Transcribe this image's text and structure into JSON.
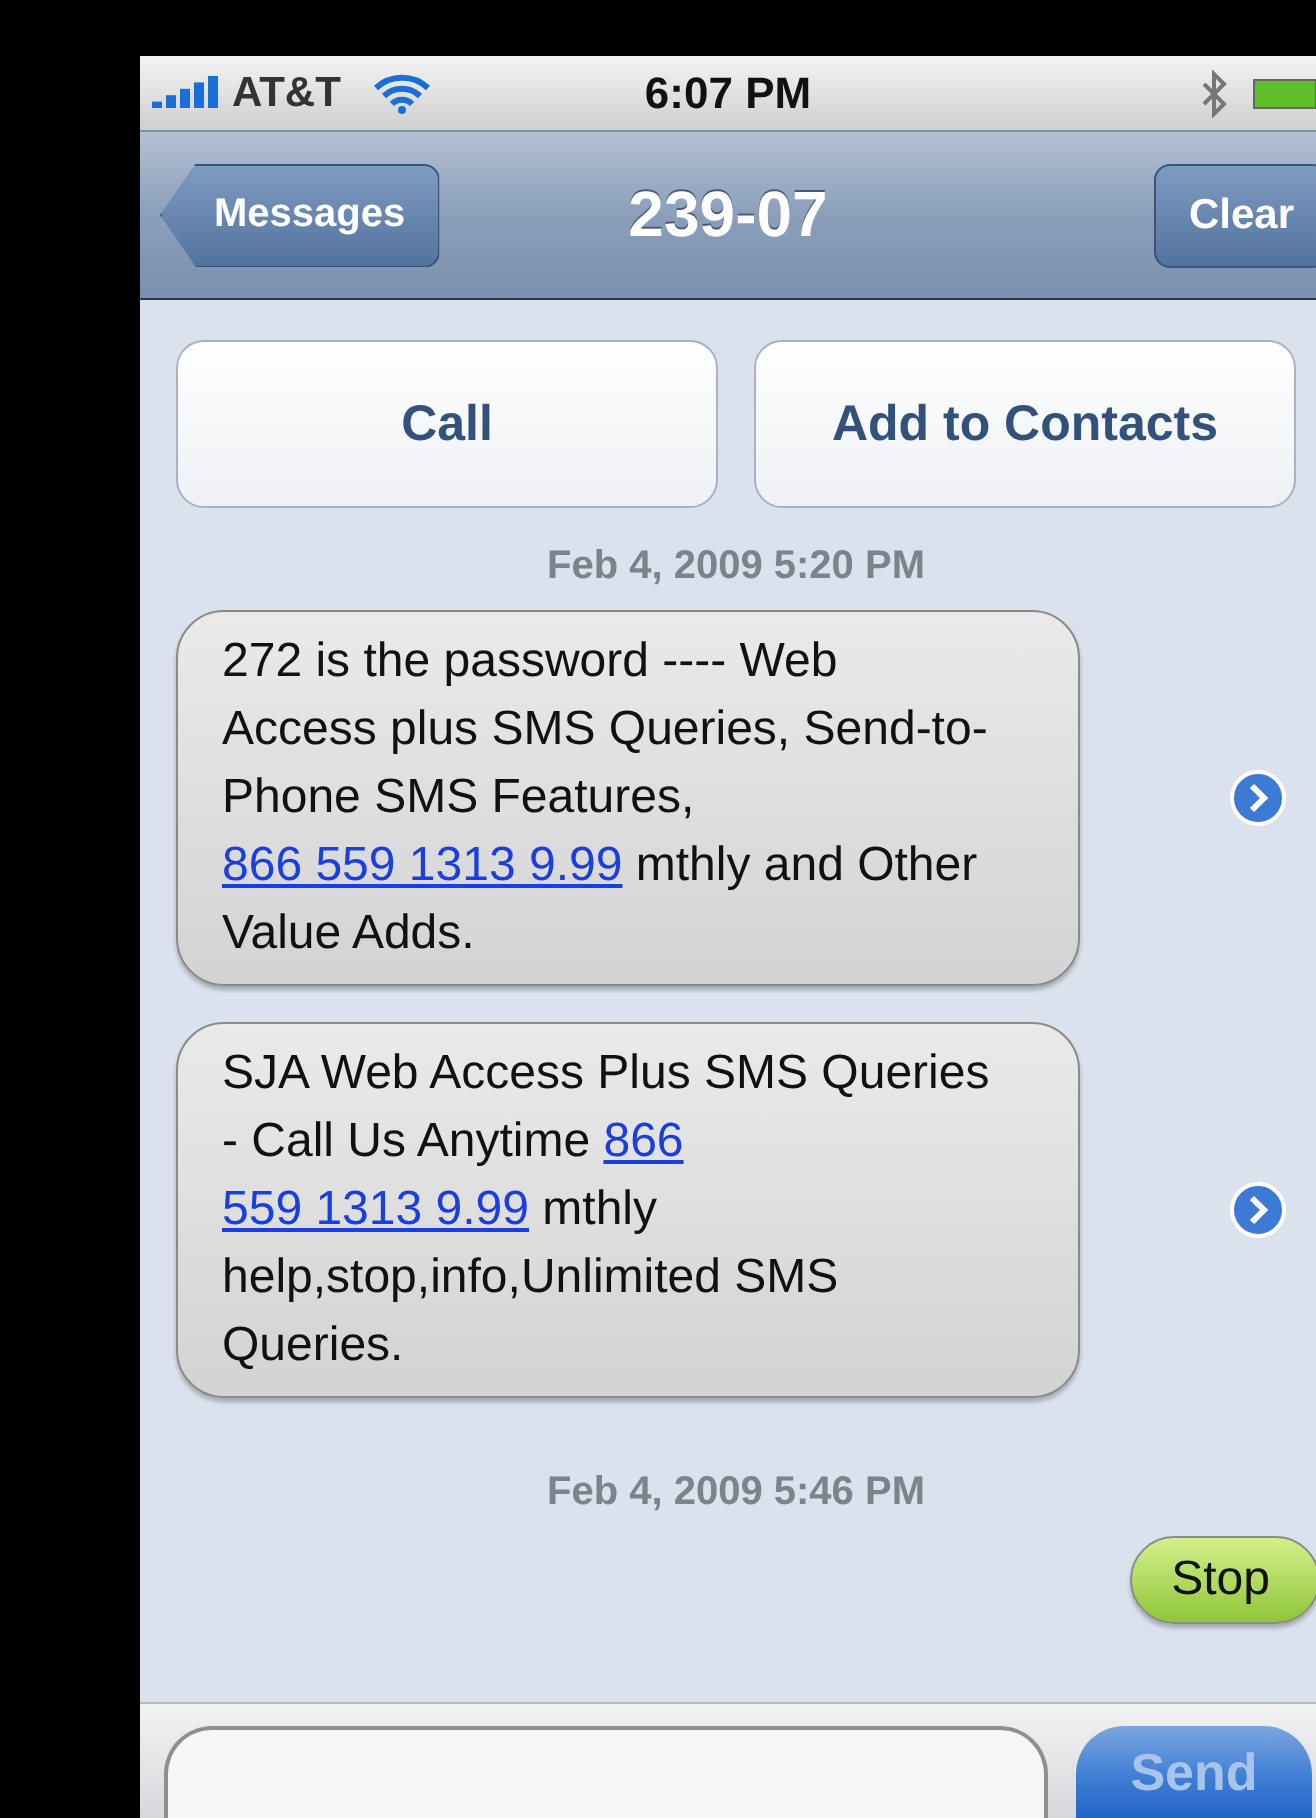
{
  "status_bar": {
    "carrier": "AT&T",
    "time": "6:07 PM",
    "bluetooth": true
  },
  "nav_bar": {
    "back": "Messages",
    "title": "239-07",
    "action": "Clear"
  },
  "actions": [
    "Call",
    "Add to Contacts"
  ],
  "thread": [
    {
      "kind": "timestamp",
      "text": "Feb 4, 2009 5:20 PM"
    },
    {
      "kind": "received",
      "segments": [
        {
          "kind": "text",
          "text": "272 is the password ---- Web Access plus SMS Queries, Send-to-Phone SMS Features, "
        },
        {
          "kind": "link",
          "text": "866 559 1313 9.99"
        },
        {
          "kind": "text",
          "text": " mthly and Other Value Adds."
        }
      ]
    },
    {
      "kind": "received",
      "segments": [
        {
          "kind": "text",
          "text": "SJA Web Access Plus SMS Queries - Call Us Anytime "
        },
        {
          "kind": "link",
          "text": "866"
        },
        {
          "kind": "link",
          "text": "559 1313 9.99"
        },
        {
          "kind": "text",
          "text": " mthly help,stop,info,Unlimited SMS Queries."
        }
      ]
    },
    {
      "kind": "timestamp",
      "text": "Feb 4, 2009 5:46 PM"
    },
    {
      "kind": "sent",
      "segments": [
        {
          "kind": "text",
          "text": "Stop"
        }
      ]
    }
  ],
  "composer": {
    "send": "Send",
    "disabled": true
  }
}
